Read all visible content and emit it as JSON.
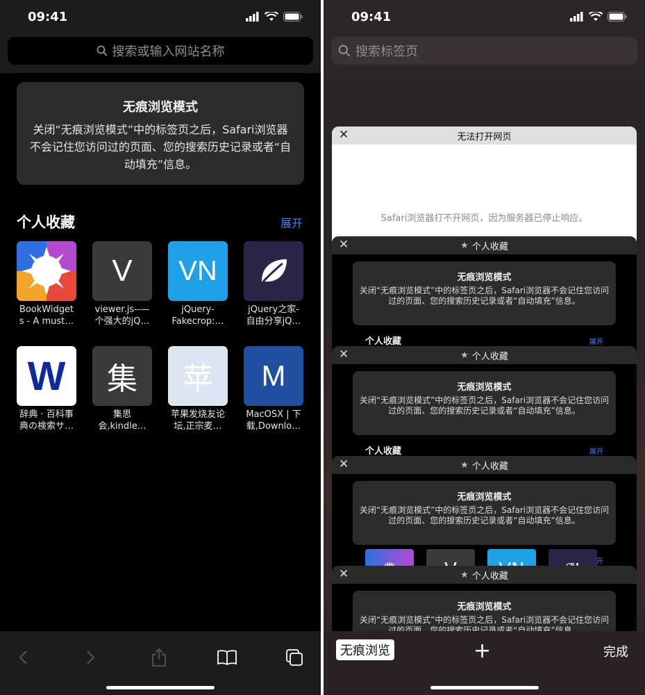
{
  "status": {
    "time_left": "09:41",
    "time_right": "09:41"
  },
  "left": {
    "search_placeholder": "搜索或输入网站名称",
    "private_card": {
      "title": "无痕浏览模式",
      "body": "关闭“无痕浏览模式”中的标签页之后，Safari浏览器不会记住您访问过的页面、您的搜索历史记录或者“自动填充”信息。"
    },
    "favorites": {
      "heading": "个人收藏",
      "expand": "展开",
      "items": [
        {
          "glyph": "",
          "label": "BookWidget\ns - A must…",
          "icon": "sun-burst-icon"
        },
        {
          "glyph": "V",
          "label": "viewer.js--—\n个强大的jQ…",
          "icon": "letter-v-icon"
        },
        {
          "glyph": "VN",
          "label": "jQuery-\nFakecrop:…",
          "icon": "letters-vn-icon"
        },
        {
          "glyph": "",
          "label": "jQuery之家-\n自由分享jQ…",
          "icon": "leaf-icon"
        },
        {
          "glyph": "W",
          "label": "辞典 · 百科事\n典の検索サ…",
          "icon": "letter-w-icon"
        },
        {
          "glyph": "集",
          "label": "集思\n会,kindle…",
          "icon": "char-ji-icon"
        },
        {
          "glyph": "苹",
          "label": "苹果发烧友论\n坛,正宗麦…",
          "icon": "char-ping-icon"
        },
        {
          "glyph": "M",
          "label": "MacOSX | 下\n载,Downlo…",
          "icon": "letter-m-icon"
        }
      ]
    }
  },
  "right": {
    "search_placeholder": "搜索标签页",
    "tabs": [
      {
        "title": "无法打开网页",
        "message": "Safari浏览器打不开网页，因为服务器已停止响应。",
        "kind": "error"
      },
      {
        "title": "个人收藏",
        "kind": "private"
      },
      {
        "title": "个人收藏",
        "kind": "private"
      },
      {
        "title": "个人收藏",
        "kind": "private"
      },
      {
        "title": "个人收藏",
        "kind": "private"
      }
    ],
    "mini_info": {
      "title": "无痕浏览模式",
      "body": "关闭“无痕浏览模式”中的标签页之后，Safari浏览器不会记住您访问过的页面、您的搜索历史记录或者“自动填充”信息。"
    },
    "mini_fav": {
      "heading": "个人收藏",
      "expand": "展开"
    },
    "close_glyph": "✕",
    "toolbar": {
      "private_label": "无痕浏览",
      "plus_label": "+",
      "done_label": "完成"
    }
  }
}
